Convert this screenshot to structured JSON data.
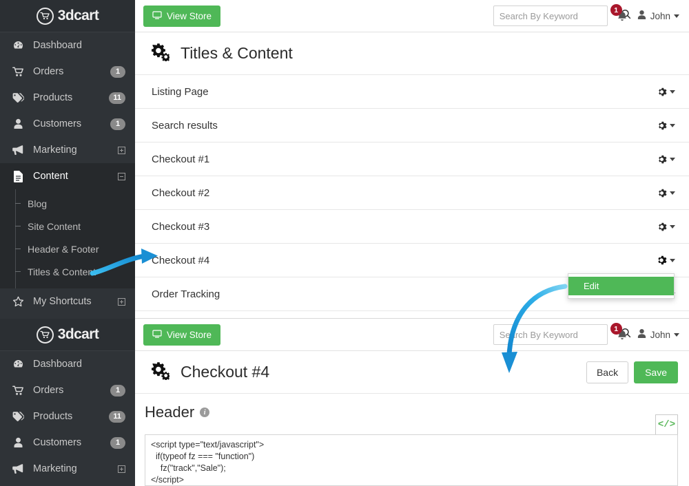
{
  "brand": {
    "logo_text": "3dcart",
    "logo_icon": "shopping-cart-icon",
    "accent_green": "#4fb857",
    "sidebar_bg": "#2f3337",
    "badge_red": "#a9172b",
    "arrow_blue": "#1f9ede"
  },
  "sidebar": {
    "items": [
      {
        "label": "Dashboard",
        "icon": "dashboard-icon",
        "badge": "",
        "expander": ""
      },
      {
        "label": "Orders",
        "icon": "cart-icon",
        "badge": "1",
        "expander": ""
      },
      {
        "label": "Products",
        "icon": "tag-icon",
        "badge": "11",
        "expander": ""
      },
      {
        "label": "Customers",
        "icon": "user-icon",
        "badge": "1",
        "expander": ""
      },
      {
        "label": "Marketing",
        "icon": "megaphone-icon",
        "badge": "",
        "expander": "plus"
      },
      {
        "label": "Content",
        "icon": "document-icon",
        "badge": "",
        "expander": "minus"
      }
    ],
    "submenu": [
      {
        "label": "Blog"
      },
      {
        "label": "Site Content"
      },
      {
        "label": "Header & Footer"
      },
      {
        "label": "Titles & Content"
      }
    ],
    "shortcuts": {
      "label": "My Shortcuts",
      "icon": "star-icon",
      "expander": "plus"
    },
    "items_bottom": [
      {
        "label": "Dashboard",
        "icon": "dashboard-icon",
        "badge": ""
      },
      {
        "label": "Orders",
        "icon": "cart-icon",
        "badge": "1"
      },
      {
        "label": "Products",
        "icon": "tag-icon",
        "badge": "11"
      },
      {
        "label": "Customers",
        "icon": "user-icon",
        "badge": "1"
      },
      {
        "label": "Marketing",
        "icon": "megaphone-icon",
        "badge": "",
        "expander": "plus"
      }
    ]
  },
  "topbar": {
    "view_store_label": "View Store",
    "view_store_icon": "monitor-icon",
    "search_placeholder": "Search By Keyword",
    "search_value": "",
    "search_icon": "search-icon",
    "bell_icon": "bell-icon",
    "notification_count": "1",
    "user_icon": "user-avatar-icon",
    "user_name": "John",
    "user_caret": "chevron-down-icon"
  },
  "panel_top": {
    "page_icon": "cogs-icon",
    "page_title": "Titles & Content",
    "rows": [
      {
        "label": "Listing Page"
      },
      {
        "label": "Search results"
      },
      {
        "label": "Checkout #1"
      },
      {
        "label": "Checkout #2"
      },
      {
        "label": "Checkout #3"
      },
      {
        "label": "Checkout #4"
      },
      {
        "label": "Order Tracking"
      }
    ],
    "row_action_icon": "gear-icon",
    "dropdown": {
      "items": [
        "Edit"
      ]
    }
  },
  "panel_bottom": {
    "page_icon": "cogs-icon",
    "page_title": "Checkout #4",
    "back_label": "Back",
    "save_label": "Save",
    "section_title": "Header",
    "section_info_icon": "info-icon",
    "code_toggle_icon": "code-icon",
    "code_toggle_label": "</>",
    "code_value": "<script type=\"text/javascript\">\n  if(typeof fz === \"function\")\n    fz(\"track\",\"Sale\");\n</script>"
  },
  "annotations": {
    "arrow_1": "arrow-to-titles-and-content",
    "arrow_2": "arrow-to-checkout-4-editor"
  }
}
